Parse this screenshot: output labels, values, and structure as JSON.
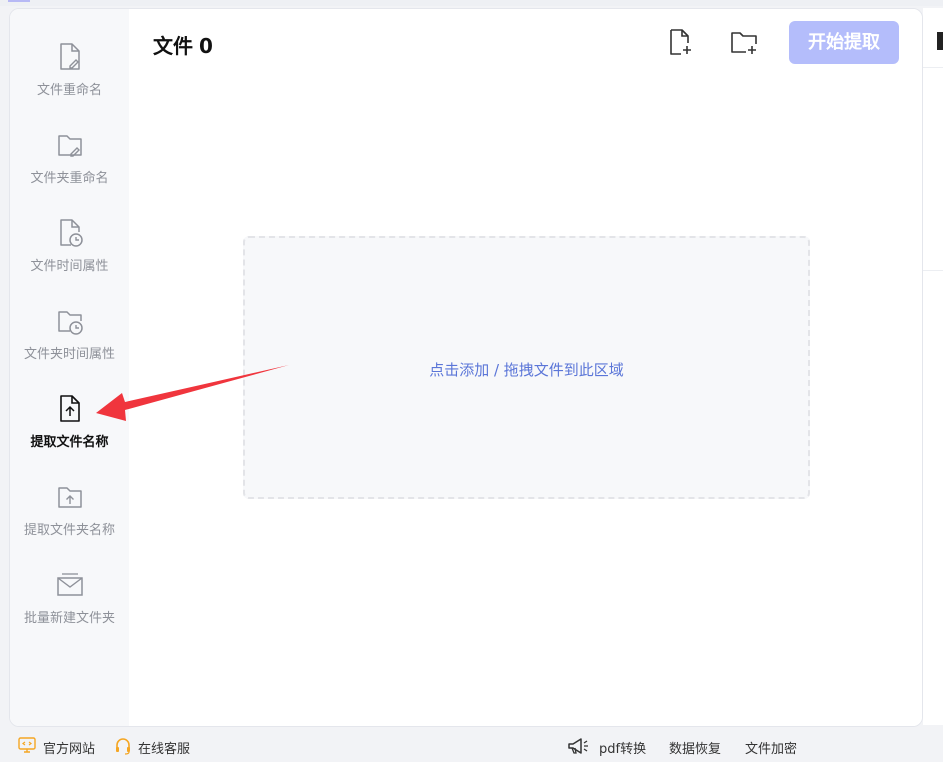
{
  "header": {
    "title": "文件",
    "count": "0",
    "start_label": "开始提取"
  },
  "sidebar": {
    "items": [
      {
        "label": "文件重命名",
        "icon": "file-edit-icon"
      },
      {
        "label": "文件夹重命名",
        "icon": "folder-edit-icon"
      },
      {
        "label": "文件时间属性",
        "icon": "file-clock-icon"
      },
      {
        "label": "文件夹时间属性",
        "icon": "folder-clock-icon"
      },
      {
        "label": "提取文件名称",
        "icon": "file-upload-icon",
        "active": true
      },
      {
        "label": "提取文件夹名称",
        "icon": "folder-upload-icon"
      },
      {
        "label": "批量新建文件夹",
        "icon": "folders-stack-icon"
      }
    ]
  },
  "dropzone": {
    "hint": "点击添加 / 拖拽文件到此区域"
  },
  "footer": {
    "website": "官方网站",
    "support": "在线客服",
    "pdf": "pdf转换",
    "recover": "数据恢复",
    "encrypt": "文件加密"
  },
  "colors": {
    "accent": "#b4bdfb",
    "hint_text": "#5b76d8",
    "arrow": "#f0353d",
    "footer_icon": "#f5a623"
  }
}
